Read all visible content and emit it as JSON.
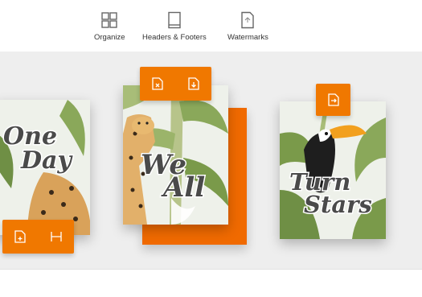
{
  "toolbar": {
    "items": [
      {
        "label": "Organize",
        "icon": "organize-grid-icon"
      },
      {
        "label": "Headers & Footers",
        "icon": "header-footer-page-icon"
      },
      {
        "label": "Watermarks",
        "icon": "watermark-page-icon"
      }
    ]
  },
  "pages": [
    {
      "line1": "One",
      "line2": "Day",
      "actions": [
        "insert-page-icon",
        "split-icon"
      ]
    },
    {
      "line1": "We",
      "line2": "All",
      "actions": [
        "delete-page-icon",
        "extract-page-icon"
      ]
    },
    {
      "line1": "Turn",
      "line2": "Stars",
      "actions": [
        "replace-page-icon"
      ]
    }
  ],
  "colors": {
    "accent": "#f07800",
    "stage": "#eeeeee",
    "leaf": "#7a9a4a",
    "toucan_beak": "#f2a01e"
  }
}
